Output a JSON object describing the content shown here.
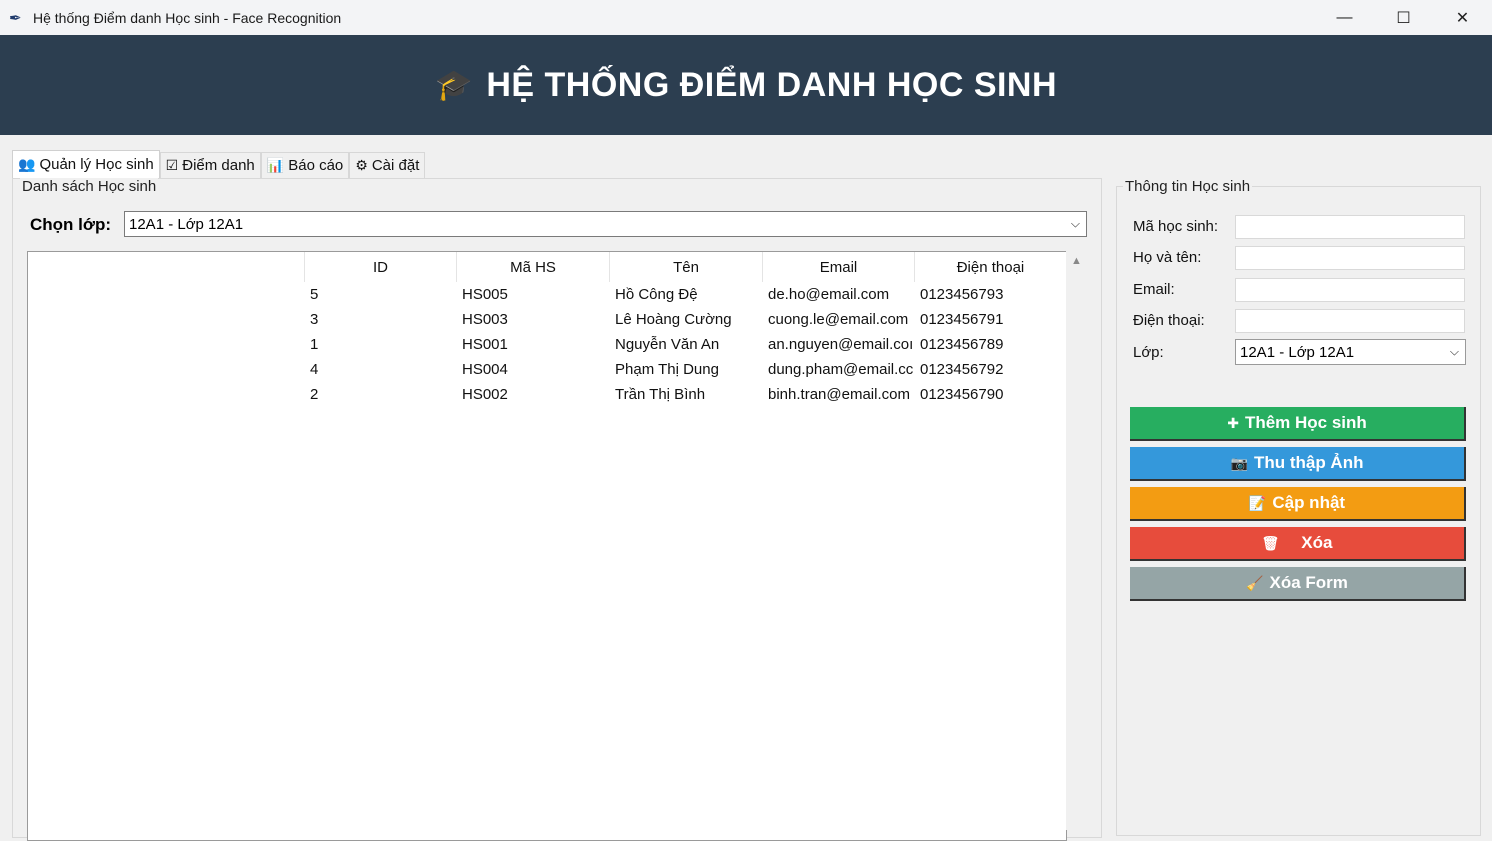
{
  "window": {
    "title": "Hệ thống Điểm danh Học sinh - Face Recognition",
    "controls": {
      "minimize": "—",
      "maximize": "☐",
      "close": "✕"
    }
  },
  "banner": {
    "icon": "graduation-cap-icon",
    "icon_glyph": "🎓",
    "title": "HỆ THỐNG ĐIỂM DANH HỌC SINH"
  },
  "tabs": [
    {
      "label": "Quản lý Học sinh",
      "icon": "people-icon",
      "glyph": "👥",
      "active": true
    },
    {
      "label": "Điểm danh",
      "icon": "checkbox-icon",
      "glyph": "☑",
      "active": false
    },
    {
      "label": "Báo cáo",
      "icon": "bar-chart-icon",
      "glyph": "📊",
      "active": false
    },
    {
      "label": "Cài đặt",
      "icon": "gear-icon",
      "glyph": "⚙",
      "active": false
    }
  ],
  "list_panel": {
    "legend": "Danh sách Học sinh",
    "class_label": "Chọn lớp:",
    "class_value": "12A1 - Lớp 12A1",
    "columns": [
      "ID",
      "Mã HS",
      "Tên",
      "Email",
      "Điện thoại"
    ],
    "rows": [
      [
        "5",
        "HS005",
        "Hồ Công Đệ",
        "de.ho@email.com",
        "0123456793"
      ],
      [
        "3",
        "HS003",
        "Lê Hoàng Cường",
        "cuong.le@email.com",
        "0123456791"
      ],
      [
        "1",
        "HS001",
        "Nguyễn Văn An",
        "an.nguyen@email.coı",
        "0123456789"
      ],
      [
        "4",
        "HS004",
        "Phạm Thị Dung",
        "dung.pham@email.cc",
        "0123456792"
      ],
      [
        "2",
        "HS002",
        "Trần Thị Bình",
        "binh.tran@email.com",
        "0123456790"
      ]
    ]
  },
  "info_panel": {
    "legend": "Thông tin Học sinh",
    "fields": [
      {
        "label": "Mã học sinh:",
        "value": ""
      },
      {
        "label": "Họ và tên:",
        "value": ""
      },
      {
        "label": "Email:",
        "value": ""
      },
      {
        "label": "Điện thoại:",
        "value": ""
      }
    ],
    "class_label": "Lớp:",
    "class_value": "12A1 - Lớp 12A1"
  },
  "actions": [
    {
      "label": "Thêm Học sinh",
      "glyph": "✚",
      "icon": "plus-icon",
      "color": "#27ae60"
    },
    {
      "label": "Thu thập Ảnh",
      "glyph": "📷",
      "icon": "camera-icon",
      "color": "#3498db"
    },
    {
      "label": "Cập nhật",
      "glyph": "📝",
      "icon": "edit-icon",
      "color": "#f39c12"
    },
    {
      "label": "Xóa",
      "glyph": "🗑",
      "icon": "trash-icon",
      "color": "#e74c3c"
    },
    {
      "label": "Xóa Form",
      "glyph": "🧹",
      "icon": "broom-icon",
      "color": "#95a5a6"
    }
  ]
}
